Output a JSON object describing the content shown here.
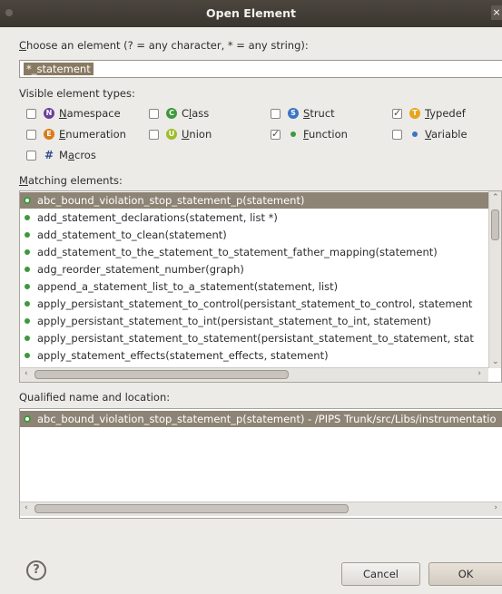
{
  "window": {
    "title": "Open Element"
  },
  "filter": {
    "label_mnemonic": "C",
    "label_rest": "hoose an element (? = any character, * = any string):",
    "value": "*_statement"
  },
  "types": {
    "label": "Visible element types:",
    "items": [
      {
        "mnemonic": "N",
        "rest": "amespace",
        "pre": "",
        "checked": false,
        "icon": "N",
        "color": "#6a3fa0"
      },
      {
        "mnemonic": "l",
        "rest": "ass",
        "pre": "C",
        "checked": false,
        "icon": "C",
        "color": "#3c9a3c"
      },
      {
        "mnemonic": "S",
        "rest": "truct",
        "pre": "",
        "checked": false,
        "icon": "S",
        "color": "#3a74c4"
      },
      {
        "mnemonic": "T",
        "rest": "ypedef",
        "pre": "",
        "checked": true,
        "icon": "T",
        "color": "#e7a51b"
      },
      {
        "mnemonic": "E",
        "rest": "numeration",
        "pre": "",
        "checked": false,
        "icon": "E",
        "color": "#d97b1b"
      },
      {
        "mnemonic": "U",
        "rest": "nion",
        "pre": "",
        "checked": false,
        "icon": "U",
        "color": "#9fbd2a"
      },
      {
        "mnemonic": "F",
        "rest": "unction",
        "pre": "",
        "checked": true,
        "icon": "function-dot",
        "color": "#3c9a3c"
      },
      {
        "mnemonic": "V",
        "rest": "ariable",
        "pre": "",
        "checked": false,
        "icon": "variable-dot",
        "color": "#3a74c4"
      },
      {
        "mnemonic": "a",
        "rest": "cros",
        "pre": "M",
        "checked": false,
        "icon": "#",
        "color": "#2f4f8a"
      }
    ]
  },
  "matching": {
    "label_mnemonic": "M",
    "label_rest": "atching elements:",
    "items": [
      "abc_bound_violation_stop_statement_p(statement)",
      "add_statement_declarations(statement, list *)",
      "add_statement_to_clean(statement)",
      "add_statement_to_the_statement_to_statement_father_mapping(statement)",
      "adg_reorder_statement_number(graph)",
      "append_a_statement_list_to_a_statement(statement, list)",
      "apply_persistant_statement_to_control(persistant_statement_to_control, statement",
      "apply_persistant_statement_to_int(persistant_statement_to_int, statement)",
      "apply_persistant_statement_to_statement(persistant_statement_to_statement, stat",
      "apply_statement_effects(statement_effects, statement)"
    ],
    "selected_index": 0
  },
  "qualified": {
    "label": "Qualified name and location:",
    "items": [
      "abc_bound_violation_stop_statement_p(statement) - /PIPS Trunk/src/Libs/instrumentatio"
    ]
  },
  "buttons": {
    "help": "?",
    "cancel": "Cancel",
    "ok": "OK"
  },
  "colors": {
    "selection": "#8d8475",
    "titlebar": "#3f3a34",
    "function_green": "#3c9a3c"
  }
}
